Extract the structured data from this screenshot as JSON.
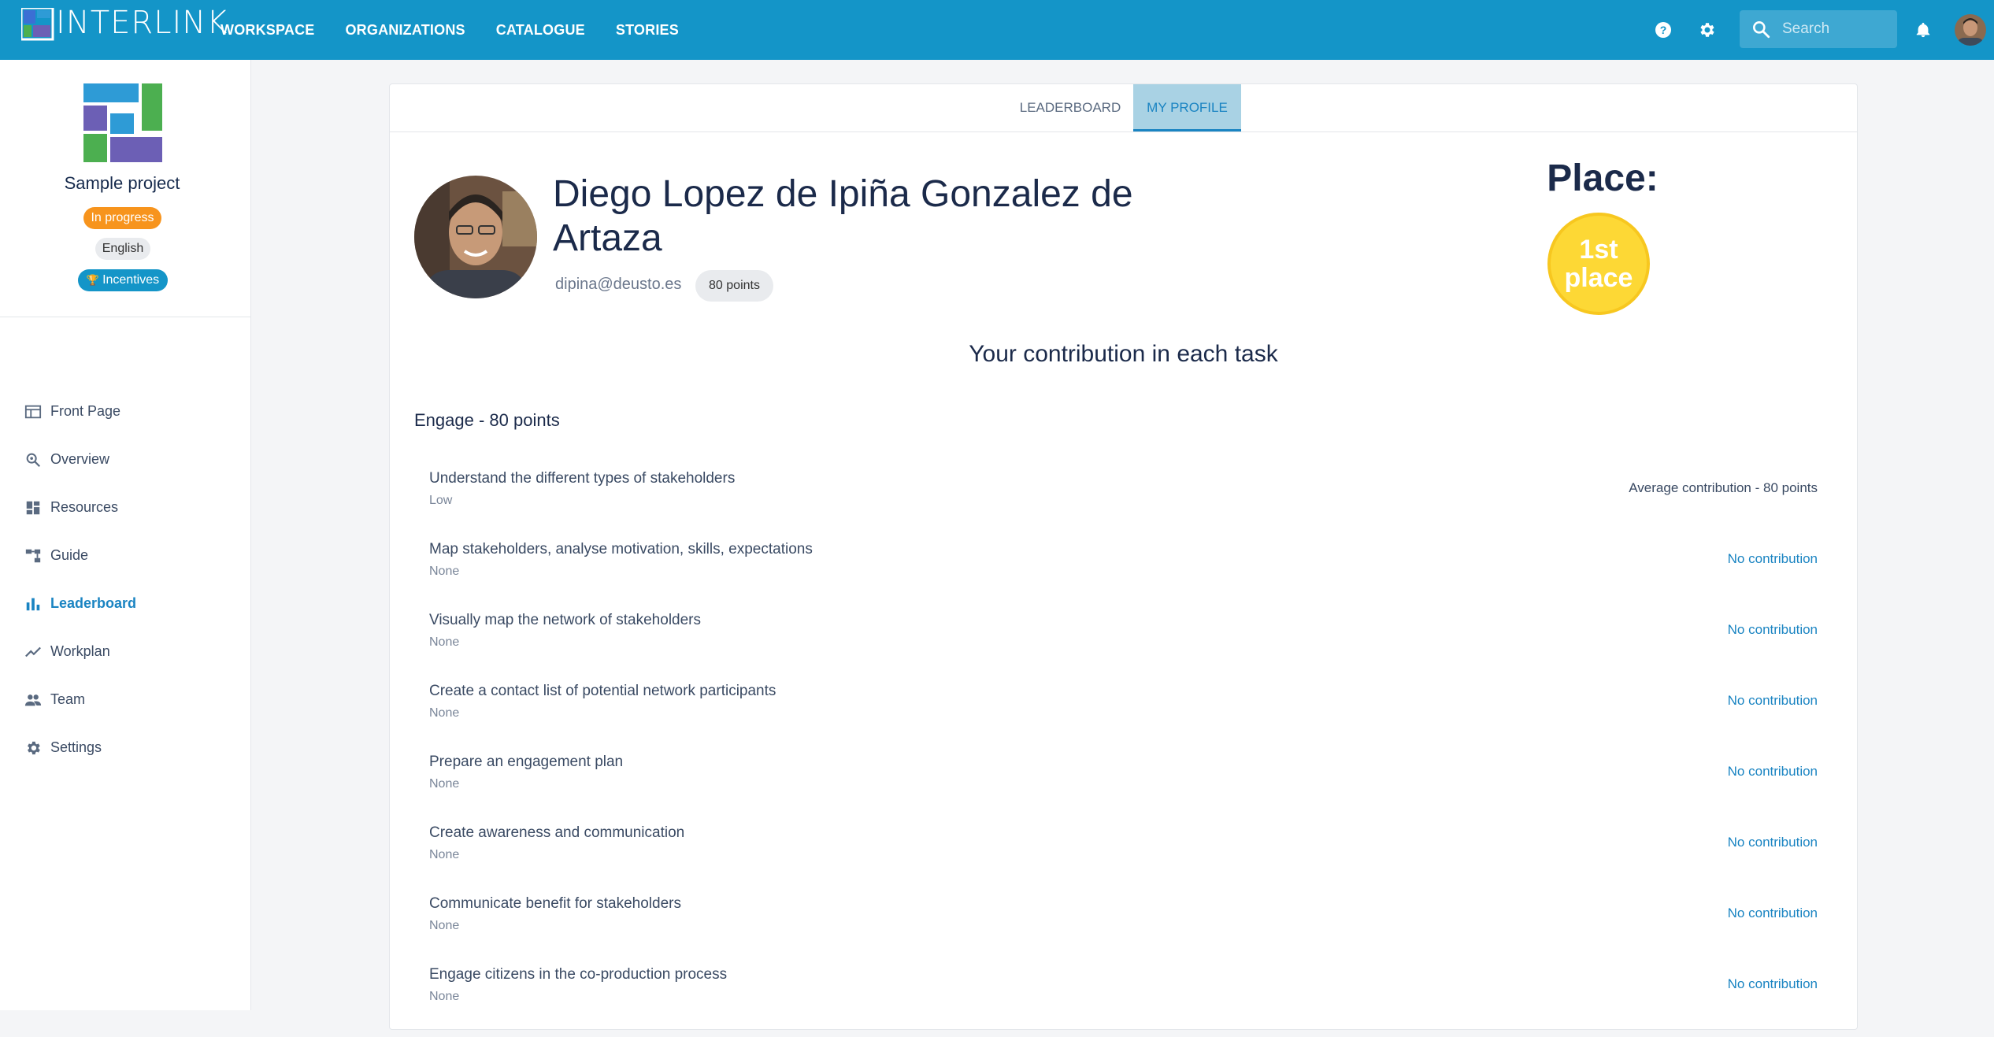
{
  "header": {
    "brand": "INTERLINK",
    "nav": [
      "WORKSPACE",
      "ORGANIZATIONS",
      "CATALOGUE",
      "STORIES"
    ],
    "search_placeholder": "Search",
    "icons": [
      "help-icon",
      "gear-icon",
      "search-icon",
      "bell-icon"
    ]
  },
  "sidebar": {
    "project_name": "Sample project",
    "status": "In progress",
    "language": "English",
    "incentives": "Incentives",
    "items": [
      {
        "label": "Front Page",
        "icon": "front-page-icon",
        "active": false
      },
      {
        "label": "Overview",
        "icon": "zoom-icon",
        "active": false
      },
      {
        "label": "Resources",
        "icon": "dashboard-icon",
        "active": false
      },
      {
        "label": "Guide",
        "icon": "tree-icon",
        "active": false
      },
      {
        "label": "Leaderboard",
        "icon": "bar-chart-icon",
        "active": true
      },
      {
        "label": "Workplan",
        "icon": "trend-icon",
        "active": false
      },
      {
        "label": "Team",
        "icon": "team-icon",
        "active": false
      },
      {
        "label": "Settings",
        "icon": "gear-icon",
        "active": false
      }
    ]
  },
  "tabs": {
    "leaderboard": "LEADERBOARD",
    "my_profile": "MY PROFILE"
  },
  "profile": {
    "name": "Diego Lopez de Ipiña Gonzalez de Artaza",
    "email": "dipina@deusto.es",
    "points": "80 points",
    "place_label": "Place:",
    "place_value": "1st place"
  },
  "contribution": {
    "title": "Your contribution in each task",
    "section": "Engage - 80 points",
    "tasks": [
      {
        "name": "Understand the different types of stakeholders",
        "level": "Low",
        "contribution": "Average contribution - 80 points"
      },
      {
        "name": "Map stakeholders, analyse motivation, skills, expectations",
        "level": "None",
        "contribution": "No contribution"
      },
      {
        "name": "Visually map the network of stakeholders",
        "level": "None",
        "contribution": "No contribution"
      },
      {
        "name": "Create a contact list of potential network participants",
        "level": "None",
        "contribution": "No contribution"
      },
      {
        "name": "Prepare an engagement plan",
        "level": "None",
        "contribution": "No contribution"
      },
      {
        "name": "Create awareness and communication",
        "level": "None",
        "contribution": "No contribution"
      },
      {
        "name": "Communicate benefit for stakeholders",
        "level": "None",
        "contribution": "No contribution"
      },
      {
        "name": "Engage citizens in the co-production process",
        "level": "None",
        "contribution": "No contribution"
      }
    ]
  },
  "colors": {
    "primary": "#1495c8",
    "accent": "#1a84c2",
    "status_in_progress": "#f7941d",
    "place_badge": "#fdd835"
  }
}
